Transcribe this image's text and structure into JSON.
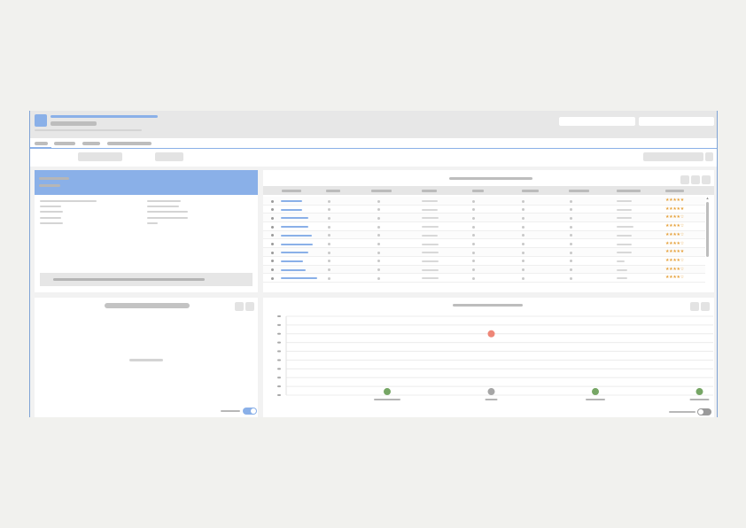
{
  "header": {
    "title": "",
    "subtitle": "",
    "path": ""
  },
  "menu": {
    "items": [
      "",
      "",
      "",
      ""
    ]
  },
  "toolbar": {
    "buttons": [
      "",
      ""
    ],
    "filter": ""
  },
  "colors": {
    "accent": "#8ab0e8",
    "link": "#8ab0e8",
    "star": "#e6a23c",
    "error_point": "#ee8677",
    "ok_point": "#76a665",
    "neutral_point": "#a6a6a6"
  },
  "icons": [
    "app-logo-icon",
    "refresh-icon",
    "settings-icon",
    "more-icon",
    "star-icon",
    "toggle-icon"
  ],
  "table": {
    "columns": [
      "",
      "",
      "",
      "",
      "",
      "",
      "",
      "",
      ""
    ],
    "rows": [
      {
        "rating": 5
      },
      {
        "rating": 5
      },
      {
        "rating": 4
      },
      {
        "rating": 4
      },
      {
        "rating": 4
      },
      {
        "rating": 4
      },
      {
        "rating": 5
      },
      {
        "rating": 4
      },
      {
        "rating": 4
      },
      {
        "rating": 4
      }
    ]
  },
  "chart_data": {
    "type": "scatter",
    "categories": [
      "",
      "",
      "",
      ""
    ],
    "y_ticks": [
      "",
      "",
      "",
      "",
      "",
      "",
      "",
      "",
      "",
      ""
    ],
    "grid": true,
    "legend": "none",
    "series": [
      {
        "status": [
          "ok",
          "neutral",
          "ok",
          "ok"
        ],
        "values": [
          0.2,
          0.2,
          0.2,
          0.2
        ]
      },
      {
        "status": [
          "error"
        ],
        "categories_index": [
          1
        ],
        "values": [
          7
        ]
      }
    ],
    "ylim": [
      0,
      9
    ]
  }
}
